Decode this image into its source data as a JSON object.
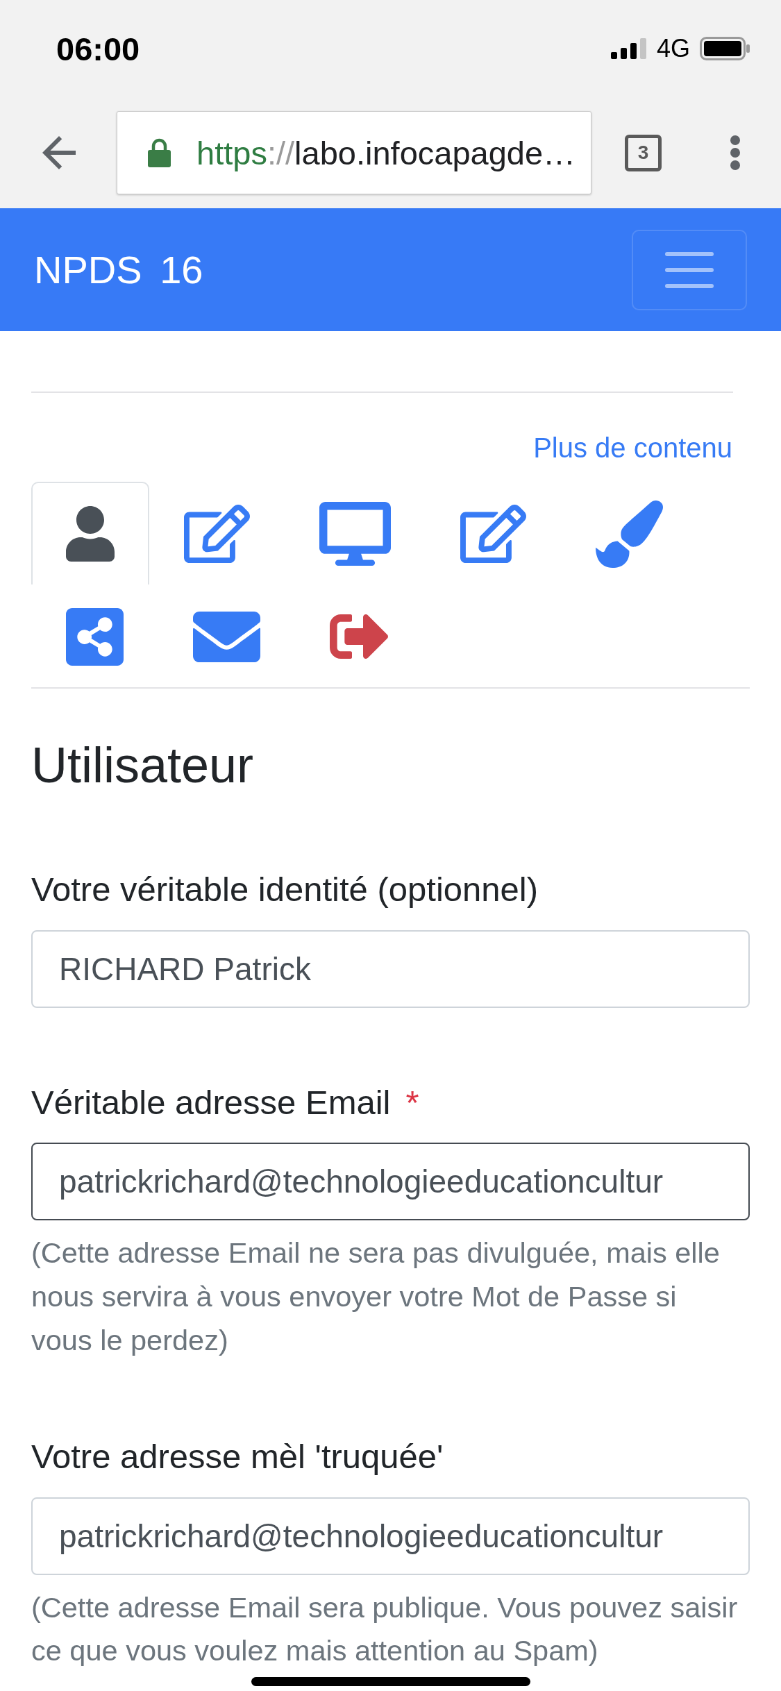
{
  "status_bar": {
    "time": "06:00",
    "network": "4G"
  },
  "browser": {
    "url": {
      "scheme": "https",
      "separator": "://",
      "host": "labo.infocapagde…"
    },
    "tab_count": "3"
  },
  "navbar": {
    "brand": "NPDS 16"
  },
  "more_link": "Plus de contenu",
  "tabs": [
    {
      "kind": "user",
      "selected": true,
      "color": "#495057"
    },
    {
      "kind": "edit",
      "selected": false,
      "color": "#377bf5"
    },
    {
      "kind": "desktop",
      "selected": false,
      "color": "#377bf5"
    },
    {
      "kind": "edit",
      "selected": false,
      "color": "#377bf5"
    },
    {
      "kind": "brush",
      "selected": false,
      "color": "#377bf5"
    },
    {
      "kind": "share",
      "selected": false,
      "color": "#377bf5"
    },
    {
      "kind": "envelope",
      "selected": false,
      "color": "#377bf5"
    },
    {
      "kind": "logout",
      "selected": false,
      "color": "#cd444b"
    }
  ],
  "section_title": "Utilisateur",
  "fields": [
    {
      "label": "Votre véritable identité (optionnel)",
      "value": "RICHARD Patrick",
      "focused": false
    },
    {
      "label": "Véritable adresse Email",
      "required_mark": "*",
      "value": "patrickrichard@technologieeducationcultur",
      "focused": true,
      "help": "(Cette adresse Email ne sera pas divulguée, mais elle nous servira à vous envoyer votre Mot de Passe si vous le perdez)"
    },
    {
      "label": "Votre adresse mèl 'truquée'",
      "value": "patrickrichard@technologieeducationcultur",
      "focused": false,
      "help": "(Cette adresse Email sera publique. Vous pouvez saisir ce que vous voulez mais attention au Spam)"
    }
  ]
}
